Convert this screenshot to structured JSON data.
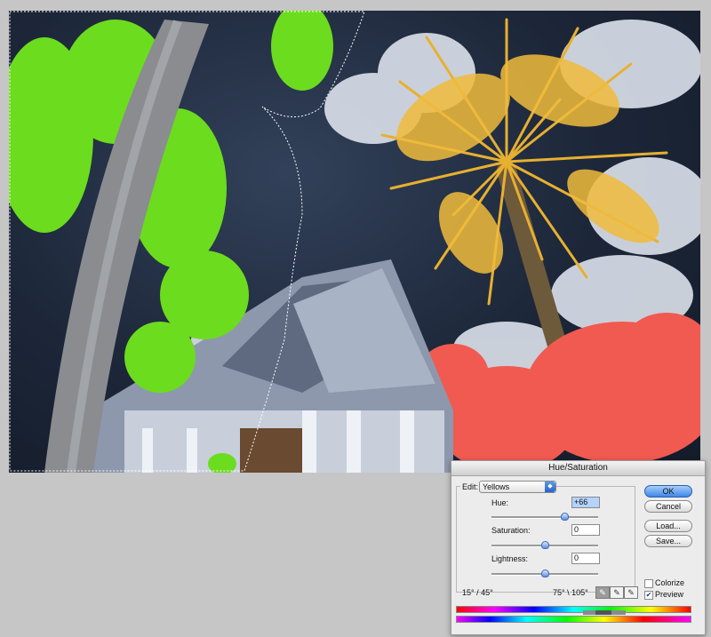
{
  "dialog": {
    "title": "Hue/Saturation",
    "edit_label": "Edit:",
    "edit_value": "Yellows",
    "hue": {
      "label": "Hue:",
      "value": "+66",
      "level": 0.68
    },
    "saturation": {
      "label": "Saturation:",
      "value": "0",
      "level": 0.5
    },
    "lightness": {
      "label": "Lightness:",
      "value": "0",
      "level": 0.5
    },
    "range_left": "15° / 45°",
    "range_right": "75° \\ 105°",
    "buttons": {
      "ok": "OK",
      "cancel": "Cancel",
      "load": "Load...",
      "save": "Save..."
    },
    "colorize": {
      "label": "Colorize",
      "checked": false
    },
    "preview": {
      "label": "Preview",
      "checked": true
    },
    "eyedroppers": [
      "eyedropper-icon",
      "eyedropper-plus-icon",
      "eyedropper-minus-icon"
    ]
  },
  "colors": {
    "background": "#c6c6c6",
    "sky": "#1c2638",
    "palm_yellow": "#e8b030",
    "foliage_green": "#6cdc1e",
    "foliage_red": "#f05a50",
    "dialog_accent": "#3f87e8"
  }
}
